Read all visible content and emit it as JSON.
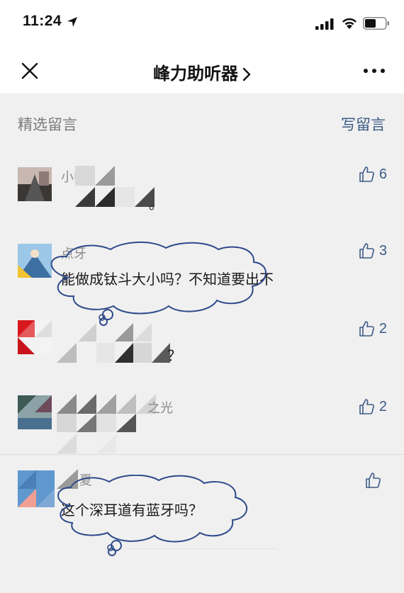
{
  "status": {
    "time": "11:24"
  },
  "nav": {
    "title": "峰力助听器"
  },
  "section": {
    "title": "精选留言",
    "write_label": "写留言"
  },
  "comments": [
    {
      "name": "小中",
      "text": "。",
      "likes": "6"
    },
    {
      "name": "点牙",
      "text": "能做成钛斗大小吗？不知道要出不",
      "likes": "3"
    },
    {
      "name": "",
      "text": "？",
      "likes": "2"
    },
    {
      "name": "之光",
      "text": "",
      "likes": "2"
    },
    {
      "name": "夏",
      "text": "这个深耳道有蓝牙吗？",
      "likes": ""
    }
  ],
  "colors": {
    "link": "#3c5a86",
    "annotation": "#2d4a8a"
  },
  "icons": {
    "close": "close-icon",
    "more": "more-icon",
    "like": "thumbs-up-icon"
  }
}
